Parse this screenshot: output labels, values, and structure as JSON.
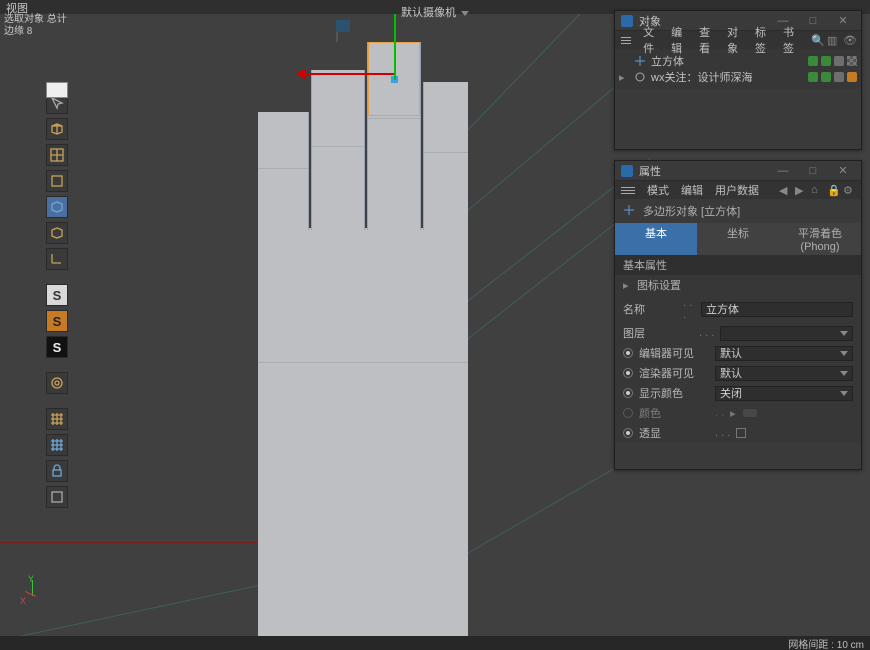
{
  "top": {
    "view_label": "视图",
    "sel_label": "选取对象 总计",
    "sel_count": "边缘  8"
  },
  "camera": {
    "label": "默认摄像机"
  },
  "status": {
    "grid_label": "网格间距 : 10 cm"
  },
  "tools": [
    "move",
    "rotate",
    "cube",
    "checker",
    "box",
    "solid-cube",
    "orange-cube",
    "angle",
    "s-grey",
    "s-orange",
    "s-black",
    "orange-misc",
    "grid1",
    "grid2",
    "lock",
    "misc"
  ],
  "objects_panel": {
    "title": "对象",
    "menu": [
      "文件",
      "编辑",
      "查看",
      "对象",
      "标签",
      "书签"
    ],
    "tree": [
      {
        "icon": "axis-icon",
        "name": "立方体",
        "indent": 0
      },
      {
        "icon": "null-icon",
        "name": "wx关注：设计师深海",
        "indent": 0
      }
    ]
  },
  "attributes_panel": {
    "title": "属性",
    "menu": [
      "模式",
      "编辑",
      "用户数据"
    ],
    "object_type": "多边形对象 [立方体]",
    "tabs": [
      "基本",
      "坐标",
      "平滑着色(Phong)"
    ],
    "active_tab": 0,
    "section_basic": "基本属性",
    "section_icon": "图标设置",
    "fields": {
      "name_label": "名称",
      "name_value": "立方体",
      "layer_label": "图层",
      "layer_value": "",
      "editor_vis_label": "编辑器可见",
      "editor_vis_value": "默认",
      "render_vis_label": "渲染器可见",
      "render_vis_value": "默认",
      "display_color_label": "显示颜色",
      "display_color_value": "关闭",
      "color_label": "颜色",
      "xray_label": "透显"
    }
  }
}
